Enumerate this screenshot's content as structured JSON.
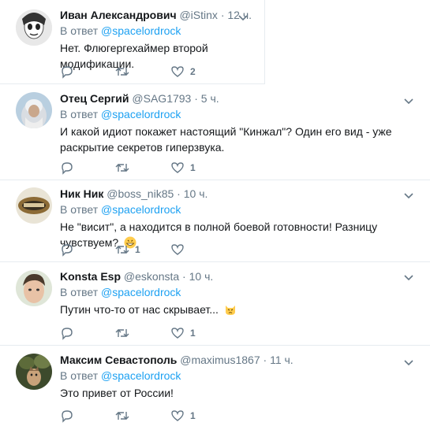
{
  "tweets": [
    {
      "name": "Иван Александрович",
      "handle": "@iStinx",
      "time": "12 ч.",
      "reply_prefix": "В ответ",
      "reply_handle": "@spacelordrock",
      "text": "Нет. Флюгергехаймер второй модификации.",
      "reply_count": "",
      "retweet_count": "",
      "like_count": "2"
    },
    {
      "name": "Отец Сергий",
      "handle": "@SAG1793",
      "time": "5 ч.",
      "reply_prefix": "В ответ",
      "reply_handle": "@spacelordrock",
      "text": "И какой идиот покажет настоящий \"Кинжал\"? Один его вид - уже раскрытие секретов гиперзвука.",
      "reply_count": "",
      "retweet_count": "",
      "like_count": "1"
    },
    {
      "name": "Ник Ник",
      "handle": "@boss_nik85",
      "time": "10 ч.",
      "reply_prefix": "В ответ",
      "reply_handle": "@spacelordrock",
      "text": "Не \"висит\", а находится в полной боевой готовности! Разницу чувствуем?",
      "emoji": "grinning-face-emoji",
      "reply_count": "",
      "retweet_count": "1",
      "like_count": ""
    },
    {
      "name": "Konsta Esp",
      "handle": "@eskonsta",
      "time": "10 ч.",
      "reply_prefix": "В ответ",
      "reply_handle": "@spacelordrock",
      "text": "Путин что-то от нас скрывает...",
      "emoji": "pouting-cat-emoji",
      "reply_count": "",
      "retweet_count": "",
      "like_count": "1"
    },
    {
      "name": "Максим Севастополь",
      "handle": "@maximus1867",
      "time": "11 ч.",
      "reply_prefix": "В ответ",
      "reply_handle": "@spacelordrock",
      "text": "Это привет от России!",
      "reply_count": "",
      "retweet_count": "",
      "like_count": "1"
    }
  ],
  "icons": {
    "reply": "reply-icon",
    "retweet": "retweet-icon",
    "like": "heart-icon",
    "caret": "chevron-down-icon"
  },
  "colors": {
    "mention": "#1da1f2",
    "meta": "#657786",
    "text": "#14171a",
    "divider": "#e6ecf0"
  }
}
